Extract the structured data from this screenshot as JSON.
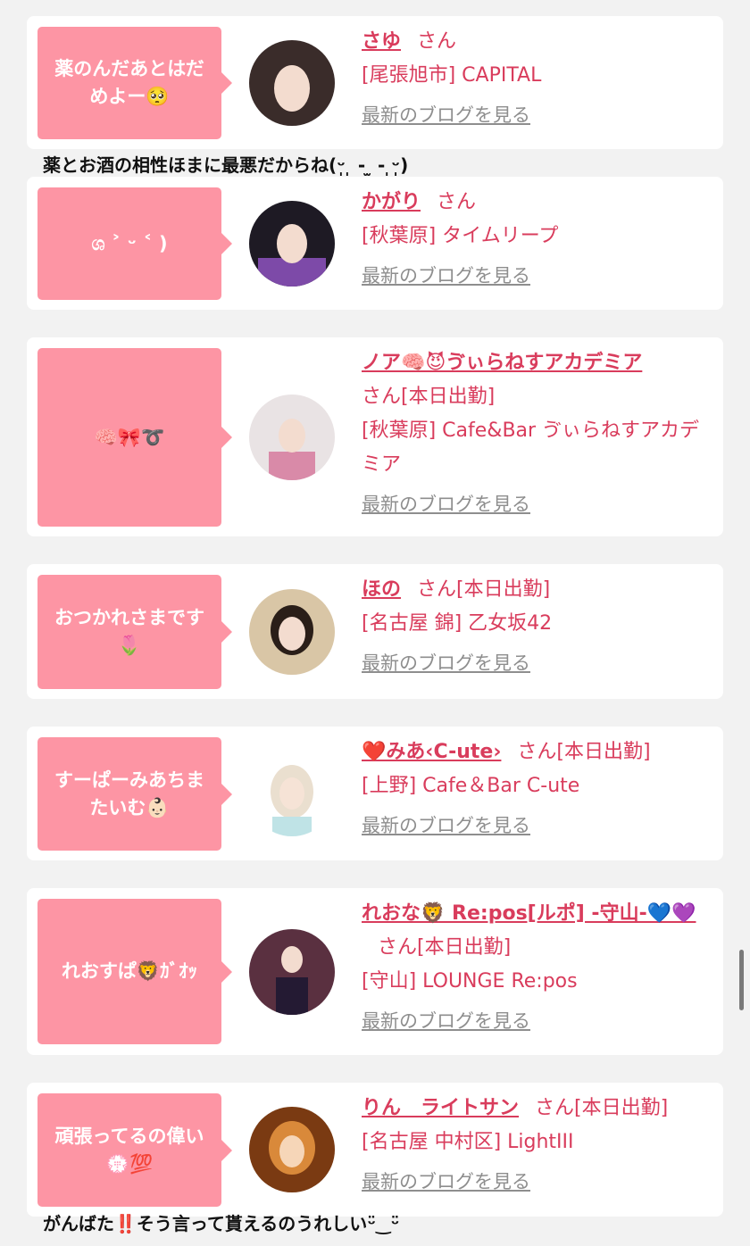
{
  "cards": [
    {
      "bubble": "薬のんだあとはだめよー🥺",
      "name": "さゆ",
      "suffix": "さん",
      "shop": "[尾張旭市] CAPITAL",
      "blog": "最新のブログを見る",
      "avatar_colors": [
        "#3a2c2a",
        "#f3dccf"
      ],
      "comment": "薬とお酒の相性ほまに最悪だからね(ᵕ̩̩ ̩ ‑ ̫ ‑ ̩ᵕ̩̩)"
    },
    {
      "bubble": "ශ ˃ ᵕ ˂ )",
      "name": "かがり",
      "suffix": "さん",
      "shop": "[秋葉原] タイムリープ",
      "blog": "最新のブログを見る",
      "avatar_colors": [
        "#1e1a24",
        "#7d4aa8"
      ]
    },
    {
      "bubble": "🧠🎀➰",
      "name": "ノア🧠😈ゔぃらねすアカデミア",
      "suffix": "さん[本日出勤]",
      "shop": "[秋葉原] Cafe&Bar ゔぃらねすアカデミア",
      "blog": "最新のブログを見る",
      "avatar_colors": [
        "#e9e3e4",
        "#d98aa8"
      ]
    },
    {
      "bubble": "おつかれさまです🌷",
      "name": "ほの",
      "suffix": "さん[本日出勤]",
      "shop": "[名古屋 錦] 乙女坂42",
      "blog": "最新のブログを見る",
      "avatar_colors": [
        "#d9c6a6",
        "#2a1e18"
      ]
    },
    {
      "bubble": "すーぱーみあちまたいむ👶🏻",
      "name": "❤️みあ‹C-ute›",
      "suffix": "さん[本日出勤]",
      "shop": "[上野] Cafe＆Bar C-ute",
      "blog": "最新のブログを見る",
      "avatar_colors": [
        "#eadfcf",
        "#f1e6d7"
      ]
    },
    {
      "bubble": "れおすぱ🦁ｶﾞｵｯ",
      "name": "れおな🦁 Re:pos[ルポ] -守山-💙💜",
      "suffix": "さん[本日出勤]",
      "shop": "[守山] LOUNGE Re:pos",
      "blog": "最新のブログを見る",
      "avatar_colors": [
        "#5a3040",
        "#241a33"
      ]
    },
    {
      "bubble": "頑張ってるの偉い💮💯",
      "name": "りん　ライトサン",
      "suffix": "さん[本日出勤]",
      "shop": "[名古屋 中村区] LightIII",
      "blog": "最新のブログを見る",
      "avatar_colors": [
        "#7a3a12",
        "#d9893a"
      ],
      "comment": "がんばた‼️そう言って貰えるのうれしいᵕ̈‿ᵕ̈"
    }
  ],
  "colors": {
    "accent": "#d93c5c",
    "bubble": "#fd95a4",
    "link_gray": "#8e8e8e"
  }
}
